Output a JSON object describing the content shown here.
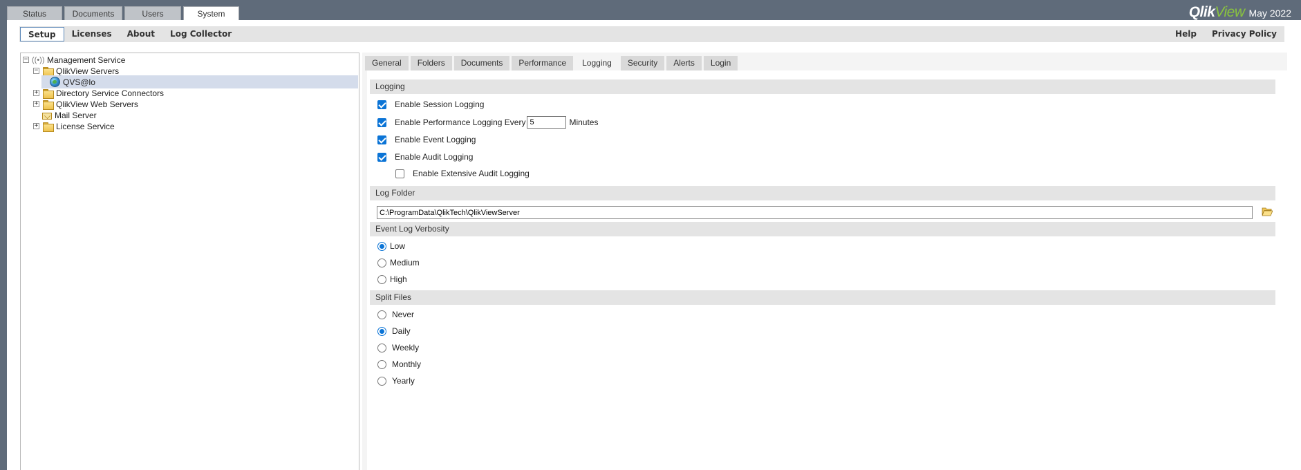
{
  "top_tabs": [
    {
      "label": "Status",
      "active": false
    },
    {
      "label": "Documents",
      "active": false
    },
    {
      "label": "Users",
      "active": false
    },
    {
      "label": "System",
      "active": true
    }
  ],
  "brand": {
    "logo_text_a": "Qlik",
    "logo_text_b": "View",
    "version": "May 2022"
  },
  "subnav": {
    "left": [
      {
        "label": "Setup",
        "active": true
      },
      {
        "label": "Licenses"
      },
      {
        "label": "About"
      },
      {
        "label": "Log Collector"
      }
    ],
    "right": [
      {
        "label": "Help"
      },
      {
        "label": "Privacy Policy"
      }
    ]
  },
  "tree": {
    "items": [
      {
        "label": "Management Service",
        "icon": "service-icon",
        "expander": "−"
      },
      {
        "label": "QlikView Servers",
        "icon": "folder-icon",
        "expander": "−"
      },
      {
        "label": "QVS@lo",
        "icon": "globe-icon",
        "selected": true
      },
      {
        "label": "Directory Service Connectors",
        "icon": "folder-icon",
        "expander": "+"
      },
      {
        "label": "QlikView Web Servers",
        "icon": "folder-icon",
        "expander": "+"
      },
      {
        "label": "Mail Server",
        "icon": "mail-icon"
      },
      {
        "label": "License Service",
        "icon": "folder-icon",
        "expander": "+"
      }
    ]
  },
  "right_tabs": [
    {
      "label": "General"
    },
    {
      "label": "Folders"
    },
    {
      "label": "Documents"
    },
    {
      "label": "Performance"
    },
    {
      "label": "Logging",
      "active": true
    },
    {
      "label": "Security"
    },
    {
      "label": "Alerts"
    },
    {
      "label": "Login"
    }
  ],
  "logging": {
    "section_title": "Logging",
    "session": {
      "label": "Enable Session Logging",
      "checked": true
    },
    "performance": {
      "label": "Enable Performance Logging Every",
      "checked": true,
      "value": "5",
      "unit": "Minutes"
    },
    "event": {
      "label": "Enable Event Logging",
      "checked": true
    },
    "audit": {
      "label": "Enable Audit Logging",
      "checked": true
    },
    "extensive": {
      "label": "Enable Extensive Audit Logging",
      "checked": false
    }
  },
  "log_folder": {
    "section_title": "Log Folder",
    "path": "C:\\ProgramData\\QlikTech\\QlikViewServer",
    "browse_icon": "folder-open-icon"
  },
  "verbosity": {
    "section_title": "Event Log Verbosity",
    "options": [
      "Low",
      "Medium",
      "High"
    ],
    "selected": "Low"
  },
  "split_files": {
    "section_title": "Split Files",
    "options": [
      "Never",
      "Daily",
      "Weekly",
      "Monthly",
      "Yearly"
    ],
    "selected": "Daily"
  }
}
